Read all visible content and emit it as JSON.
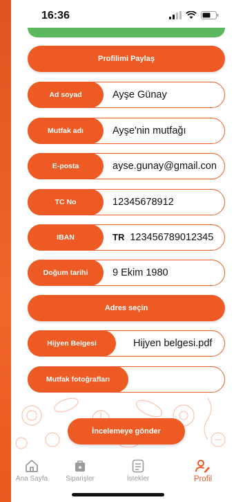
{
  "status_bar": {
    "time": "16:36"
  },
  "actions": {
    "share_profile": "Profilimi Paylaş",
    "select_address": "Adres seçin",
    "submit_review": "İncelemeye gönder"
  },
  "fields": [
    {
      "label": "Ad soyad",
      "value": "Ayşe Günay"
    },
    {
      "label": "Mutfak adı",
      "value": "Ayşe'nin mutfağı"
    },
    {
      "label": "E-posta",
      "value": "ayse.gunay@gmail.con"
    },
    {
      "label": "TC No",
      "value": "12345678912"
    },
    {
      "label": "IBAN",
      "prefix": "TR",
      "value": "123456789012345"
    },
    {
      "label": "Doğum tarihi",
      "value": "9 Ekim 1980"
    }
  ],
  "hygiene": {
    "label": "Hijyen Belgesi",
    "value": "Hijyen belgesi.pdf"
  },
  "kitchen_photos": {
    "label": "Mutfak fotoğrafları"
  },
  "tabbar": {
    "items": [
      {
        "label": "Ana Sayfa",
        "icon": "home-icon"
      },
      {
        "label": "Siparişler",
        "icon": "orders-bag-icon"
      },
      {
        "label": "İstekler",
        "icon": "list-icon"
      },
      {
        "label": "Profil",
        "icon": "profile-edit-icon",
        "active": true
      }
    ]
  },
  "colors": {
    "accent": "#ee5a24",
    "success": "#5cb85c"
  }
}
